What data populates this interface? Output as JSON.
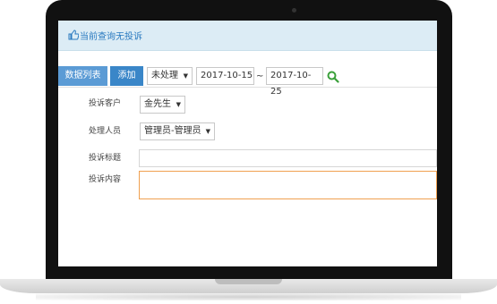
{
  "notice": {
    "icon": "thumbs-up-icon",
    "text": "当前查询无投诉"
  },
  "toolbar": {
    "list_label": "数据列表",
    "add_label": "添加",
    "status": "未处理",
    "date_from": "2017-10-15",
    "separator": "~",
    "date_to": "2017-10-25",
    "search_icon": "search-icon"
  },
  "form": {
    "customer_label": "投诉客户",
    "customer_value": "金先生",
    "handler_label": "处理人员",
    "handler_value": "管理员-管理员",
    "title_label": "投诉标题",
    "title_value": "",
    "content_label": "投诉内容",
    "content_value": ""
  },
  "colors": {
    "accent": "#3a86c8",
    "notice_bg": "#dcecf5",
    "focus_border": "#f0a050",
    "search": "#3aa03a"
  }
}
